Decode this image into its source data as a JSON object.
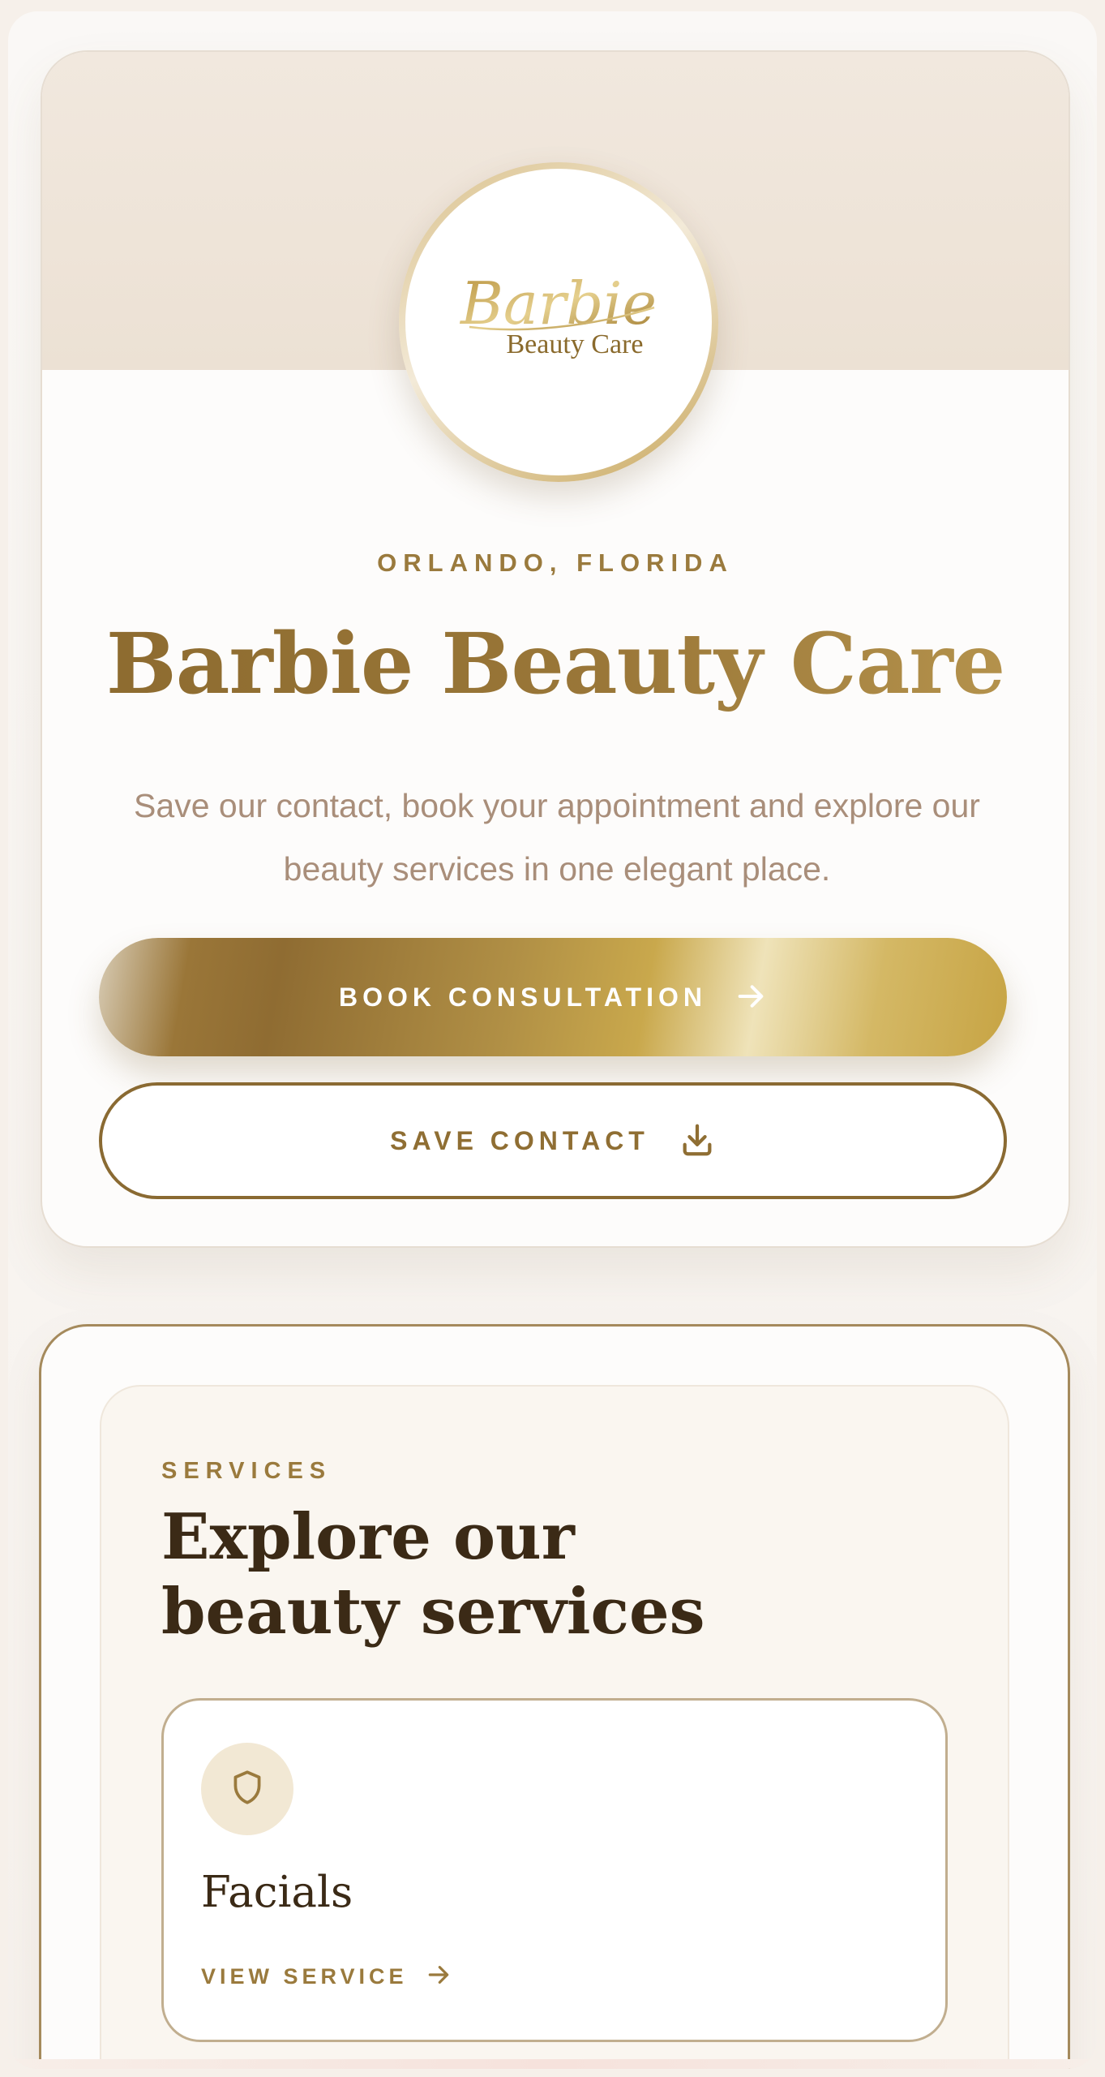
{
  "hero": {
    "logo_script": "Barbie",
    "logo_sub": "Beauty Care",
    "location": "ORLANDO, FLORIDA",
    "title": "Barbie Beauty Care",
    "tagline": "Save our contact, book your appointment and explore our beauty services in one elegant place.",
    "book_label": "BOOK CONSULTATION",
    "book_icon": "arrow-right-icon",
    "save_label": "SAVE CONTACT",
    "save_icon": "download-icon"
  },
  "services": {
    "eyebrow": "SERVICES",
    "title": "Explore our beauty services",
    "items": [
      {
        "name": "Facials",
        "icon": "shield-icon",
        "link_label": "VIEW SERVICE",
        "link_icon": "arrow-right-icon"
      }
    ]
  },
  "colors": {
    "gold": "#9a7a3d",
    "gold_dark": "#8c6a2f",
    "text_dark": "#3b2a16",
    "muted": "#a98e7a",
    "band": "#f1e8de",
    "icon_bg": "#f2e8d4"
  }
}
